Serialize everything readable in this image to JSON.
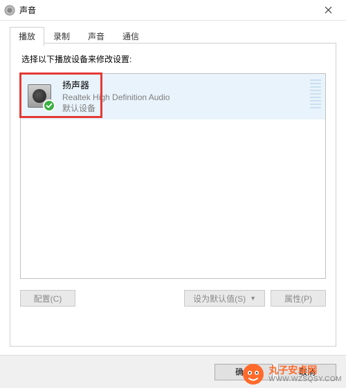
{
  "window": {
    "title": "声音"
  },
  "tabs": [
    {
      "label": "播放",
      "active": true
    },
    {
      "label": "录制",
      "active": false
    },
    {
      "label": "声音",
      "active": false
    },
    {
      "label": "通信",
      "active": false
    }
  ],
  "instruction": "选择以下播放设备来修改设置:",
  "devices": [
    {
      "name": "扬声器",
      "driver": "Realtek High Definition Audio",
      "status": "默认设备",
      "default": true
    }
  ],
  "buttons": {
    "configure": "配置(C)",
    "set_default": "设为默认值(S)",
    "properties": "属性(P)",
    "ok": "确定",
    "cancel": "取消"
  },
  "watermark": {
    "line1": "丸子安卓网",
    "line2": "WWW.WZSQSY.COM"
  }
}
